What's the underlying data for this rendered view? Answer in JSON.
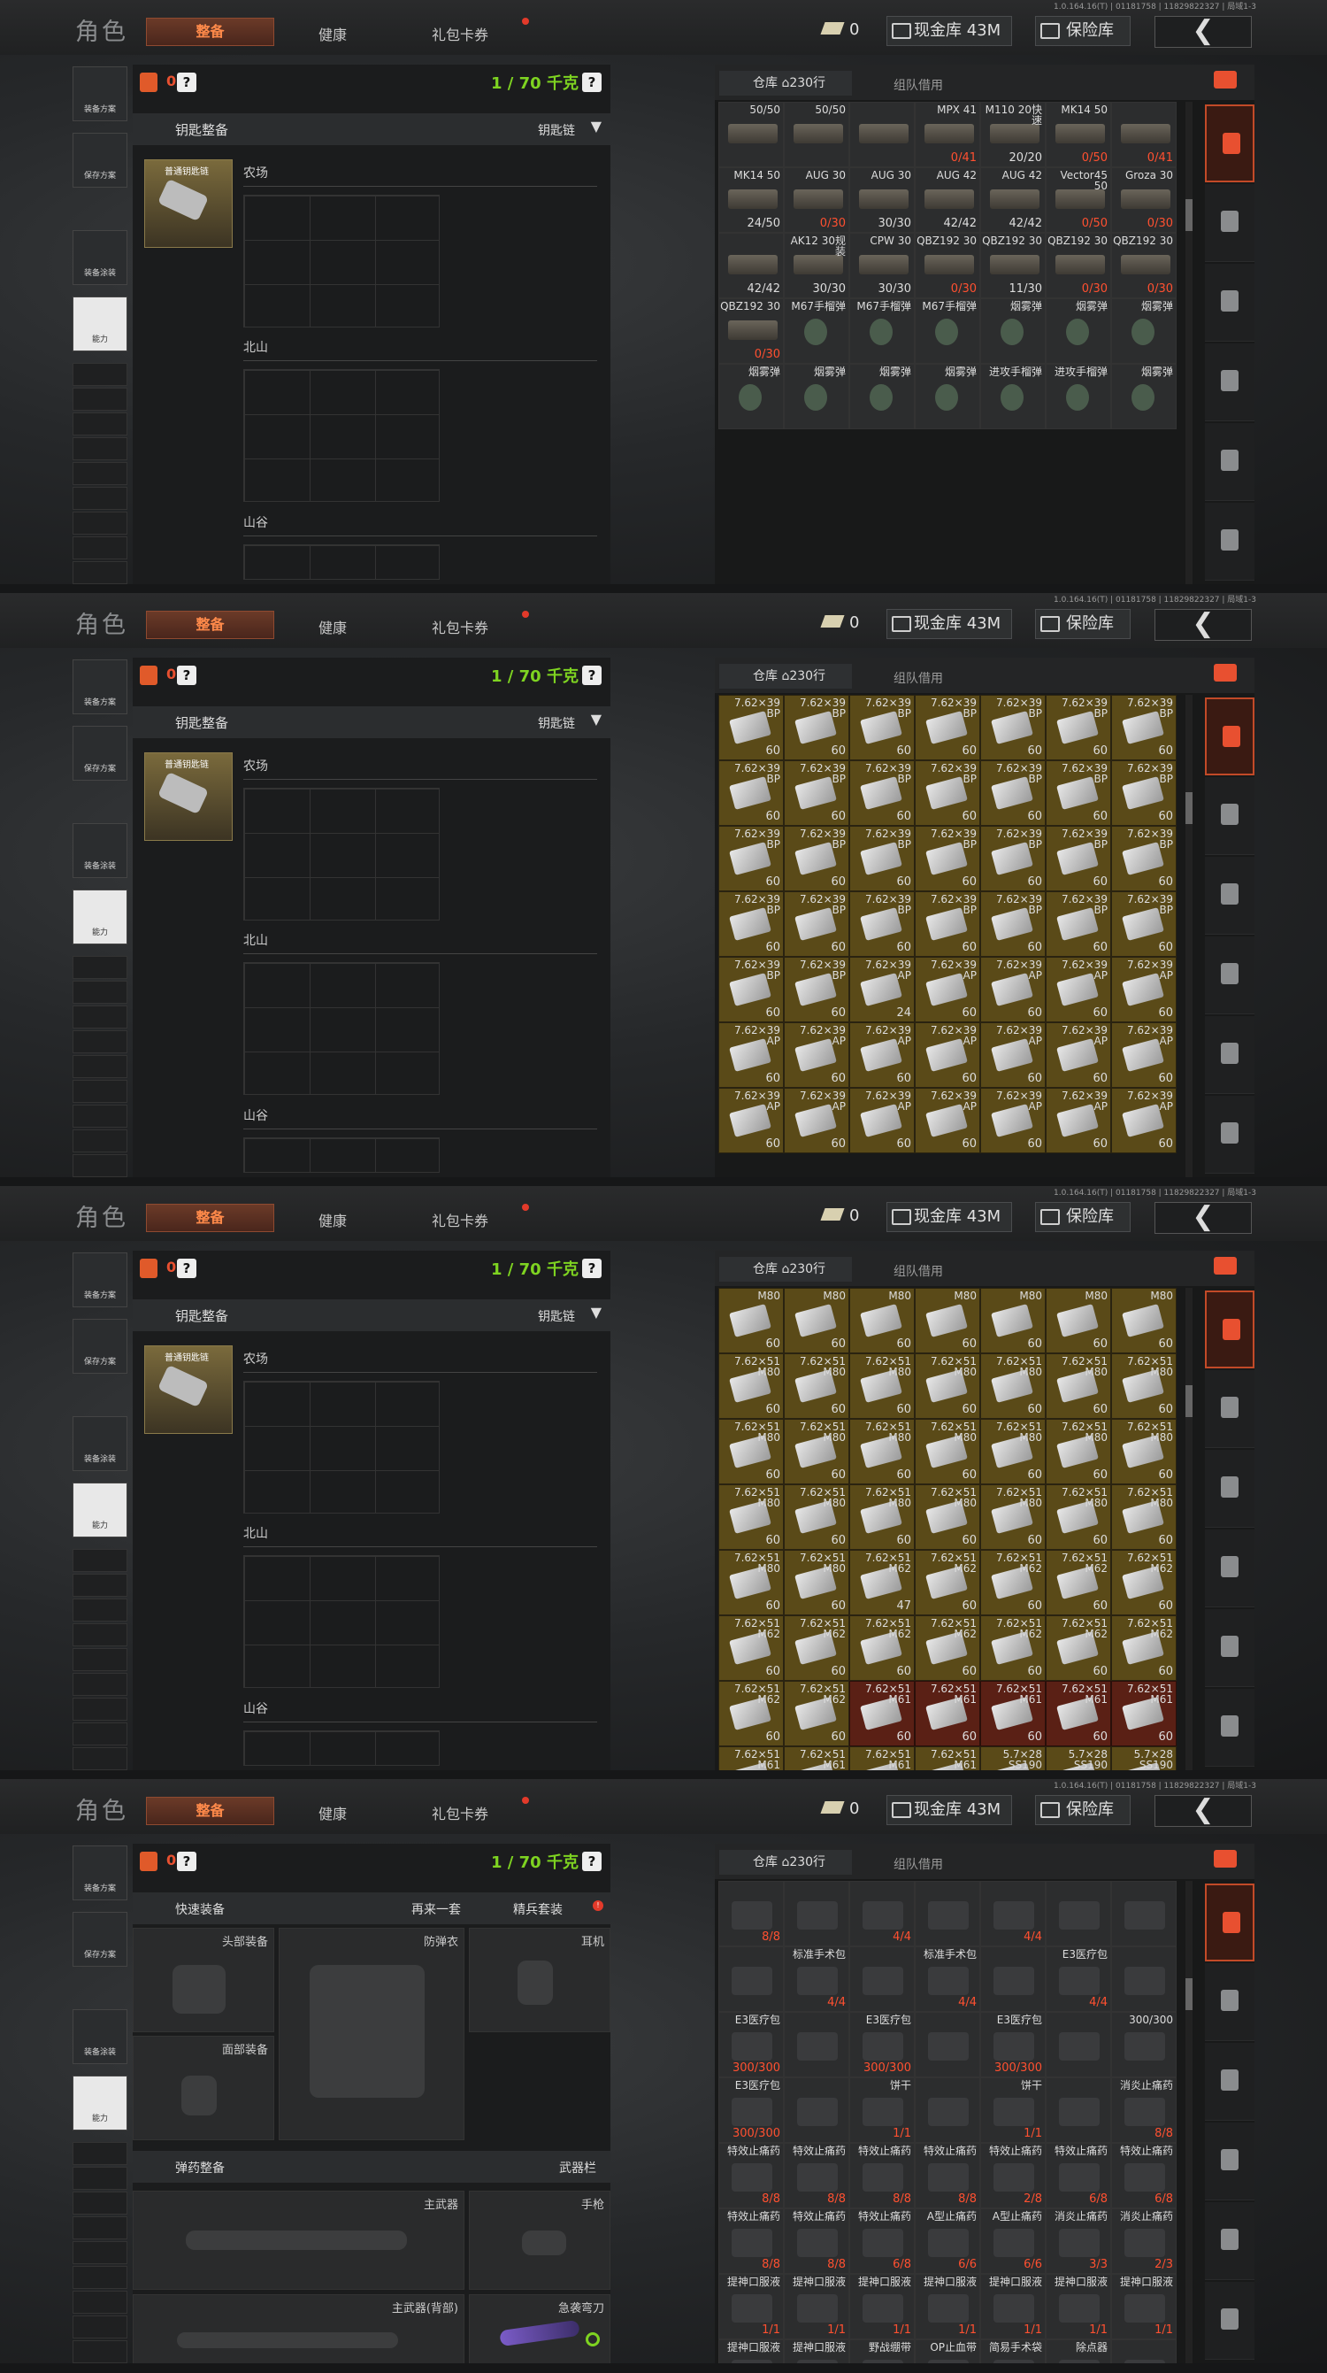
{
  "header": {
    "title": "角色",
    "tabs": [
      "整备",
      "健康",
      "礼包卡券"
    ],
    "version": "1.0.164.16(T) | 01181758 | 11829822327 | 局域1-3",
    "money": "0",
    "gold_label": "现金库 43M",
    "safe_label": "保险库",
    "back_icon": "back-chevron-icon"
  },
  "sidebar": {
    "buttons": [
      "装备方案",
      "保存方案",
      "装备涂装",
      "能力"
    ]
  },
  "loadout": {
    "bag_count": "0",
    "help": "?",
    "weight": "1 / 70 千克",
    "key_section": "钥匙整备",
    "keychain_label": "钥匙链",
    "key_item": "普通钥匙链",
    "slots": [
      "农场",
      "北山",
      "山谷"
    ],
    "quick_equip": "快速装备",
    "again": "再来一套",
    "elite_set": "精兵套装",
    "gear": {
      "head": "头部装备",
      "armor": "防弹衣",
      "headset": "耳机",
      "face": "面部装备"
    },
    "ammo_section": "弹药整备",
    "weapon_bar": "武器栏",
    "weapons": {
      "main": "主武器",
      "pistol": "手枪",
      "main_back": "主武器(背部)",
      "melee": "急袭弯刀"
    }
  },
  "warehouse": {
    "tab_storage": "仓库 ⌂230行",
    "tab_team": "组队借用",
    "categories": [
      "all-items-icon",
      "armor-icon",
      "rifle-icon",
      "magazine-icon",
      "ammo-icon",
      "medkit-icon"
    ]
  },
  "panels": [
    {
      "variant": "keys",
      "cells": [
        [
          "50/50",
          "",
          ""
        ],
        [
          "50/50",
          "",
          ""
        ],
        [
          "",
          "",
          ""
        ],
        [
          "MPX 41",
          "0/41",
          "red"
        ],
        [
          "M110 20快速",
          "20/20",
          ""
        ],
        [
          "MK14 50",
          "0/50",
          "red"
        ],
        [
          "",
          "0/41",
          "red"
        ],
        [
          "MK14 50",
          "24/50",
          ""
        ],
        [
          "AUG 30",
          "0/30",
          "red"
        ],
        [
          "AUG 30",
          "30/30",
          ""
        ],
        [
          "AUG 42",
          "42/42",
          ""
        ],
        [
          "AUG 42",
          "42/42",
          ""
        ],
        [
          "Vector45 50",
          "0/50",
          "red"
        ],
        [
          "Groza 30",
          "0/30",
          "red"
        ],
        [
          "",
          "42/42",
          ""
        ],
        [
          "AK12 30规装",
          "30/30",
          ""
        ],
        [
          "CPW 30",
          "30/30",
          ""
        ],
        [
          "QBZ192 30",
          "0/30",
          "red"
        ],
        [
          "QBZ192 30",
          "11/30",
          ""
        ],
        [
          "QBZ192 30",
          "0/30",
          "red"
        ],
        [
          "QBZ192 30",
          "0/30",
          "red"
        ],
        [
          "QBZ192 30",
          "0/30",
          "red"
        ],
        [
          "M67手榴弹",
          "",
          ""
        ],
        [
          "M67手榴弹",
          "",
          ""
        ],
        [
          "M67手榴弹",
          "",
          ""
        ],
        [
          "烟雾弹",
          "",
          ""
        ],
        [
          "烟雾弹",
          "",
          ""
        ],
        [
          "烟雾弹",
          "",
          ""
        ],
        [
          "烟雾弹",
          "",
          ""
        ],
        [
          "烟雾弹",
          "",
          ""
        ],
        [
          "烟雾弹",
          "",
          ""
        ],
        [
          "烟雾弹",
          "",
          ""
        ],
        [
          "进攻手榴弹",
          "",
          ""
        ],
        [
          "进攻手榴弹",
          "",
          ""
        ],
        [
          "烟雾弹",
          "",
          ""
        ]
      ]
    },
    {
      "variant": "ammo762x39",
      "cells": [
        [
          "7.62×39 BP",
          "60",
          ""
        ],
        [
          "7.62×39 BP",
          "60",
          ""
        ],
        [
          "7.62×39 BP",
          "60",
          ""
        ],
        [
          "7.62×39 BP",
          "60",
          ""
        ],
        [
          "7.62×39 BP",
          "60",
          ""
        ],
        [
          "7.62×39 BP",
          "60",
          ""
        ],
        [
          "7.62×39 BP",
          "60",
          ""
        ],
        [
          "7.62×39 BP",
          "60",
          ""
        ],
        [
          "7.62×39 BP",
          "60",
          ""
        ],
        [
          "7.62×39 BP",
          "60",
          ""
        ],
        [
          "7.62×39 BP",
          "60",
          ""
        ],
        [
          "7.62×39 BP",
          "60",
          ""
        ],
        [
          "7.62×39 BP",
          "60",
          ""
        ],
        [
          "7.62×39 BP",
          "60",
          ""
        ],
        [
          "7.62×39 BP",
          "60",
          ""
        ],
        [
          "7.62×39 BP",
          "60",
          ""
        ],
        [
          "7.62×39 BP",
          "60",
          ""
        ],
        [
          "7.62×39 BP",
          "60",
          ""
        ],
        [
          "7.62×39 BP",
          "60",
          ""
        ],
        [
          "7.62×39 BP",
          "60",
          ""
        ],
        [
          "7.62×39 BP",
          "60",
          ""
        ],
        [
          "7.62×39 BP",
          "60",
          ""
        ],
        [
          "7.62×39 BP",
          "60",
          ""
        ],
        [
          "7.62×39 BP",
          "60",
          ""
        ],
        [
          "7.62×39 BP",
          "60",
          ""
        ],
        [
          "7.62×39 BP",
          "60",
          ""
        ],
        [
          "7.62×39 BP",
          "60",
          ""
        ],
        [
          "7.62×39 BP",
          "60",
          ""
        ],
        [
          "7.62×39 BP",
          "60",
          ""
        ],
        [
          "7.62×39 BP",
          "60",
          ""
        ],
        [
          "7.62×39 AP",
          "24",
          ""
        ],
        [
          "7.62×39 AP",
          "60",
          ""
        ],
        [
          "7.62×39 AP",
          "60",
          ""
        ],
        [
          "7.62×39 AP",
          "60",
          ""
        ],
        [
          "7.62×39 AP",
          "60",
          ""
        ],
        [
          "7.62×39 AP",
          "60",
          ""
        ],
        [
          "7.62×39 AP",
          "60",
          ""
        ],
        [
          "7.62×39 AP",
          "60",
          ""
        ],
        [
          "7.62×39 AP",
          "60",
          ""
        ],
        [
          "7.62×39 AP",
          "60",
          ""
        ],
        [
          "7.62×39 AP",
          "60",
          ""
        ],
        [
          "7.62×39 AP",
          "60",
          ""
        ],
        [
          "7.62×39 AP",
          "60",
          ""
        ],
        [
          "7.62×39 AP",
          "60",
          ""
        ],
        [
          "7.62×39 AP",
          "60",
          ""
        ],
        [
          "7.62×39 AP",
          "60",
          ""
        ],
        [
          "7.62×39 AP",
          "60",
          ""
        ],
        [
          "7.62×39 AP",
          "60",
          ""
        ],
        [
          "7.62×39 AP",
          "60",
          ""
        ]
      ]
    },
    {
      "variant": "ammo762x51",
      "cells": [
        [
          "M80",
          "60",
          ""
        ],
        [
          "M80",
          "60",
          ""
        ],
        [
          "M80",
          "60",
          ""
        ],
        [
          "M80",
          "60",
          ""
        ],
        [
          "M80",
          "60",
          ""
        ],
        [
          "M80",
          "60",
          ""
        ],
        [
          "M80",
          "60",
          ""
        ],
        [
          "7.62×51 M80",
          "60",
          ""
        ],
        [
          "7.62×51 M80",
          "60",
          ""
        ],
        [
          "7.62×51 M80",
          "60",
          ""
        ],
        [
          "7.62×51 M80",
          "60",
          ""
        ],
        [
          "7.62×51 M80",
          "60",
          ""
        ],
        [
          "7.62×51 M80",
          "60",
          ""
        ],
        [
          "7.62×51 M80",
          "60",
          ""
        ],
        [
          "7.62×51 M80",
          "60",
          ""
        ],
        [
          "7.62×51 M80",
          "60",
          ""
        ],
        [
          "7.62×51 M80",
          "60",
          ""
        ],
        [
          "7.62×51 M80",
          "60",
          ""
        ],
        [
          "7.62×51 M80",
          "60",
          ""
        ],
        [
          "7.62×51 M80",
          "60",
          ""
        ],
        [
          "7.62×51 M80",
          "60",
          ""
        ],
        [
          "7.62×51 M80",
          "60",
          ""
        ],
        [
          "7.62×51 M80",
          "60",
          ""
        ],
        [
          "7.62×51 M80",
          "60",
          ""
        ],
        [
          "7.62×51 M80",
          "60",
          ""
        ],
        [
          "7.62×51 M80",
          "60",
          ""
        ],
        [
          "7.62×51 M80",
          "60",
          ""
        ],
        [
          "7.62×51 M80",
          "60",
          ""
        ],
        [
          "7.62×51 M80",
          "60",
          ""
        ],
        [
          "7.62×51 M80",
          "60",
          ""
        ],
        [
          "7.62×51 M62",
          "47",
          ""
        ],
        [
          "7.62×51 M62",
          "60",
          ""
        ],
        [
          "7.62×51 M62",
          "60",
          ""
        ],
        [
          "7.62×51 M62",
          "60",
          ""
        ],
        [
          "7.62×51 M62",
          "60",
          ""
        ],
        [
          "7.62×51 M62",
          "60",
          ""
        ],
        [
          "7.62×51 M62",
          "60",
          ""
        ],
        [
          "7.62×51 M62",
          "60",
          ""
        ],
        [
          "7.62×51 M62",
          "60",
          ""
        ],
        [
          "7.62×51 M62",
          "60",
          ""
        ],
        [
          "7.62×51 M62",
          "60",
          ""
        ],
        [
          "7.62×51 M62",
          "60",
          ""
        ],
        [
          "7.62×51 M62",
          "60",
          ""
        ],
        [
          "7.62×51 M62",
          "60",
          ""
        ],
        [
          "7.62×51 M61",
          "60",
          ""
        ],
        [
          "7.62×51 M61",
          "60",
          ""
        ],
        [
          "7.62×51 M61",
          "60",
          ""
        ],
        [
          "7.62×51 M61",
          "60",
          ""
        ],
        [
          "7.62×51 M61",
          "60",
          ""
        ],
        [
          "7.62×51 M61",
          "",
          ""
        ],
        [
          "7.62×51 M61",
          "",
          ""
        ],
        [
          "7.62×51 M61",
          "",
          ""
        ],
        [
          "7.62×51 M61",
          "",
          ""
        ],
        [
          "5.7×28 SS190",
          "",
          ""
        ],
        [
          "5.7×28 SS190",
          "",
          ""
        ],
        [
          "5.7×28 SS190",
          "",
          ""
        ]
      ]
    },
    {
      "variant": "medical",
      "cells": [
        [
          "",
          "8/8",
          "red"
        ],
        [
          "",
          "",
          ""
        ],
        [
          "",
          "4/4",
          "red"
        ],
        [
          "",
          "",
          ""
        ],
        [
          "",
          "4/4",
          "red"
        ],
        [
          "",
          "",
          ""
        ],
        [
          "",
          "",
          ""
        ],
        [
          "",
          "",
          ""
        ],
        [
          "标准手术包",
          "4/4",
          "red"
        ],
        [
          "",
          "",
          ""
        ],
        [
          "标准手术包",
          "4/4",
          "red"
        ],
        [
          "",
          "",
          ""
        ],
        [
          "E3医疗包",
          "4/4",
          "red"
        ],
        [
          "",
          "",
          ""
        ],
        [
          "E3医疗包",
          "300/300",
          "red"
        ],
        [
          "",
          "",
          ""
        ],
        [
          "E3医疗包",
          "300/300",
          "red"
        ],
        [
          "",
          "",
          ""
        ],
        [
          "E3医疗包",
          "300/300",
          "red"
        ],
        [
          "",
          "",
          ""
        ],
        [
          "300/300",
          "",
          ""
        ],
        [
          "E3医疗包",
          "300/300",
          "red"
        ],
        [
          "",
          "",
          ""
        ],
        [
          "饼干",
          "1/1",
          "red"
        ],
        [
          "",
          "",
          ""
        ],
        [
          "饼干",
          "1/1",
          "red"
        ],
        [
          "",
          "",
          ""
        ],
        [
          "消炎止痛药",
          "8/8",
          "red"
        ],
        [
          "特效止痛药",
          "8/8",
          "red"
        ],
        [
          "特效止痛药",
          "8/8",
          "red"
        ],
        [
          "特效止痛药",
          "8/8",
          "red"
        ],
        [
          "特效止痛药",
          "8/8",
          "red"
        ],
        [
          "特效止痛药",
          "2/8",
          "red"
        ],
        [
          "特效止痛药",
          "6/8",
          "red"
        ],
        [
          "特效止痛药",
          "6/8",
          "red"
        ],
        [
          "特效止痛药",
          "8/8",
          "red"
        ],
        [
          "特效止痛药",
          "8/8",
          "red"
        ],
        [
          "特效止痛药",
          "6/8",
          "red"
        ],
        [
          "A型止痛药",
          "6/6",
          "red"
        ],
        [
          "A型止痛药",
          "6/6",
          "red"
        ],
        [
          "消炎止痛药",
          "3/3",
          "red"
        ],
        [
          "消炎止痛药",
          "2/3",
          "red"
        ],
        [
          "提神口服液",
          "1/1",
          "red"
        ],
        [
          "提神口服液",
          "1/1",
          "red"
        ],
        [
          "提神口服液",
          "1/1",
          "red"
        ],
        [
          "提神口服液",
          "1/1",
          "red"
        ],
        [
          "提神口服液",
          "1/1",
          "red"
        ],
        [
          "提神口服液",
          "1/1",
          "red"
        ],
        [
          "提神口服液",
          "1/1",
          "red"
        ],
        [
          "提神口服液",
          "",
          ""
        ],
        [
          "提神口服液",
          "",
          ""
        ],
        [
          "野战绷带",
          "",
          ""
        ],
        [
          "OP止血带",
          "",
          ""
        ],
        [
          "简易手术袋",
          "",
          ""
        ],
        [
          "除点器",
          "",
          ""
        ],
        [
          "",
          "",
          ""
        ]
      ]
    }
  ],
  "colors": {
    "accent": "#e85030",
    "weight": "#7ed321",
    "ammo_cell": "#5a4a18"
  }
}
